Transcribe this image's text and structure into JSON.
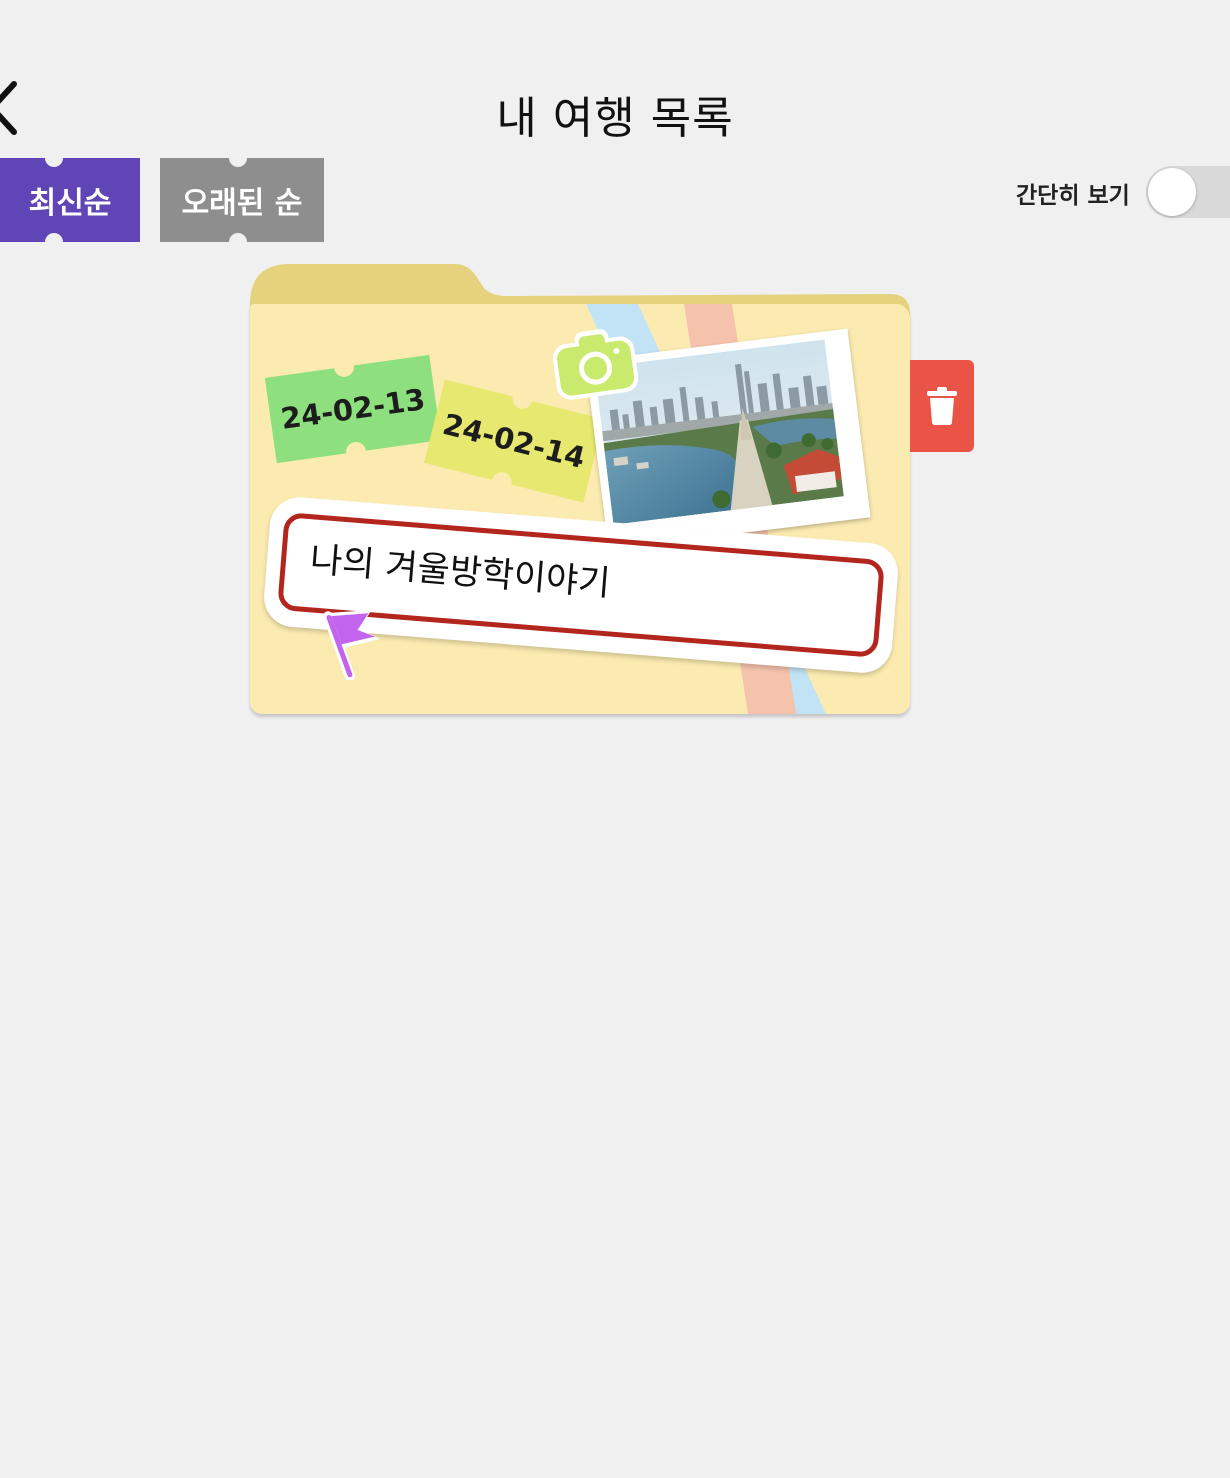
{
  "header": {
    "title": "내 여행 목록",
    "back_icon": "chevron-left-icon"
  },
  "sort_tabs": [
    {
      "label": "최신순",
      "selected": true,
      "color": "#5f45b5"
    },
    {
      "label": "오래된 순",
      "selected": false,
      "color": "#8e8e8e"
    }
  ],
  "simple_view": {
    "label": "간단히 보기",
    "enabled": false
  },
  "trips": [
    {
      "title": "나의 겨울방학이야기",
      "start_date": "24-02-13",
      "end_date": "24-02-14",
      "folder_color": "#fcebb0",
      "photo": "city-river-photo",
      "delete_icon": "trash-icon"
    }
  ],
  "colors": {
    "background": "#f0f0f0",
    "accent": "#5f45b5",
    "delete": "#ea5446",
    "title_border": "#b3261e"
  }
}
